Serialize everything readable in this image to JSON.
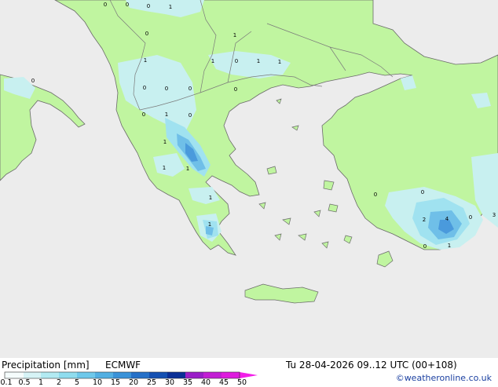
{
  "map": {
    "colors": {
      "sea": "#ececec",
      "land_dry": "#c0f5a0",
      "precip_light": "#c8f0f0",
      "precip_mid": "#a0e2f0",
      "precip_heavy": "#6fbfe8",
      "precip_peak": "#4a9adc",
      "coast": "#6a6a6a",
      "border": "#7a7a7a",
      "value_text": "#000000"
    },
    "values": [
      "0",
      "0",
      "0",
      "1",
      "0",
      "1",
      "1",
      "1",
      "0",
      "1",
      "1",
      "0",
      "0",
      "0",
      "0",
      "0",
      "1",
      "0",
      "0",
      "1",
      "1",
      "1",
      "1",
      "1",
      "0",
      "0",
      "2",
      "4",
      "0",
      "3",
      "0",
      "1"
    ]
  },
  "legend": {
    "title": "Precipitation [mm]",
    "model": "ECMWF",
    "ticks": [
      "0.1",
      "0.5",
      "1",
      "2",
      "5",
      "10",
      "15",
      "20",
      "25",
      "30",
      "35",
      "40",
      "45",
      "50"
    ],
    "colors": [
      "#f5fcfc",
      "#d6f3f6",
      "#b2eaf2",
      "#8fdcee",
      "#6ec8ea",
      "#52afe2",
      "#3a92d8",
      "#2570c8",
      "#1450b2",
      "#0a2f96",
      "#9a1ec8",
      "#c21ed4",
      "#de1cde",
      "#f21ee8"
    ]
  },
  "valid_time": "Tu 28-04-2026 09..12 UTC (00+108)",
  "credit": "©weatheronline.co.uk"
}
